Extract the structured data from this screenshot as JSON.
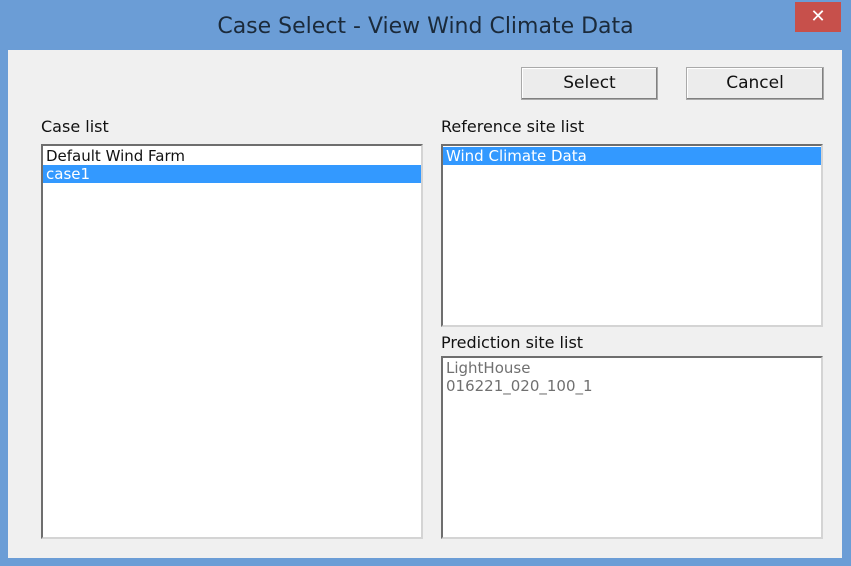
{
  "window": {
    "title": "Case Select - View Wind Climate Data",
    "close_glyph": "✕",
    "titlebar_color": "#6b9dd6",
    "close_color": "#c7504b"
  },
  "buttons": {
    "select_label": "Select",
    "cancel_label": "Cancel"
  },
  "case_list": {
    "label": "Case list",
    "items": [
      "Default Wind Farm",
      "case1"
    ],
    "selected": "case1"
  },
  "reference_site_list": {
    "label": "Reference site list",
    "items": [
      "Wind Climate Data"
    ],
    "selected": "Wind Climate Data"
  },
  "prediction_site_list": {
    "label": "Prediction site list",
    "items": [
      "LightHouse",
      "016221_020_100_1"
    ],
    "state": "disabled"
  },
  "colors": {
    "selection": "#3399ff",
    "dialog_background": "#f0f0f0"
  }
}
